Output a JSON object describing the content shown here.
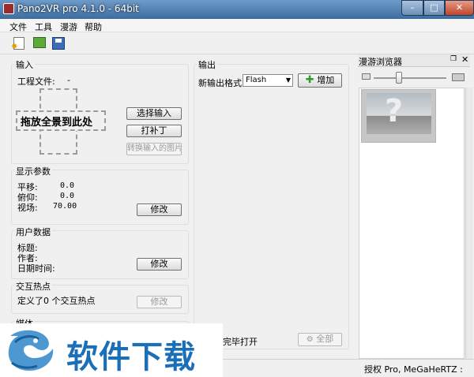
{
  "window": {
    "title": "Pano2VR pro 4.1.0 - 64bit"
  },
  "menu": {
    "items": [
      "文件",
      "工具",
      "漫游",
      "帮助"
    ]
  },
  "toolbar": {
    "icons": [
      "new-project-icon",
      "open-project-icon",
      "save-project-icon"
    ]
  },
  "input": {
    "title": "输入",
    "project_file_label": "工程文件:",
    "project_file_value": "-",
    "drop_text": "拖放全景到此处",
    "select_input_button": "选择输入",
    "patch_button": "打补丁",
    "convert_button": "转换输入的图片"
  },
  "display": {
    "title": "显示参数",
    "pan_label": "平移:",
    "pan_value": "0.0",
    "tilt_label": "俯仰:",
    "tilt_value": "0.0",
    "fov_label": "视场:",
    "fov_value": "70.00",
    "modify_button": "修改"
  },
  "userdata": {
    "title": "用户数据",
    "title_label": "标题:",
    "author_label": "作者:",
    "datetime_label": "日期时间:",
    "modify_button": "修改"
  },
  "hotspots": {
    "title": "交互热点",
    "defined_text": "定义了0 个交互热点",
    "modify_button": "修改"
  },
  "media": {
    "title": "媒体"
  },
  "output": {
    "title": "输出",
    "new_format_label": "新输出格式:",
    "format_value": "Flash",
    "add_button": "增加",
    "open_after_label": "完毕打开",
    "all_button": "全部"
  },
  "browser": {
    "title": "漫游浏览器"
  },
  "status": {
    "text": "授权 Pro, MeGaHeRTZ :"
  },
  "watermark": {
    "text": "软件下载"
  },
  "colors": {
    "titlebar": "#3d6d9f",
    "accent_green": "#2e9a2e",
    "watermark_blue": "#1b6eb8"
  }
}
